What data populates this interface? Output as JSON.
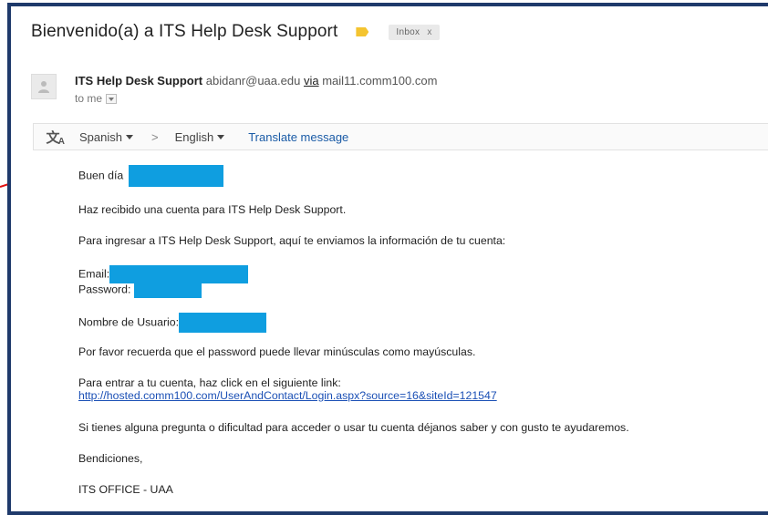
{
  "email": {
    "subject": "Bienvenido(a) a ITS Help Desk Support",
    "folder_chip": "Inbox",
    "folder_chip_close": "x",
    "sender": {
      "name": "ITS Help Desk Support",
      "address": "abidanr@uaa.edu",
      "via_label": "via",
      "via_domain": "mail11.comm100.com"
    },
    "recipient_line": "to me"
  },
  "translate": {
    "source_language": "Spanish",
    "separator": ">",
    "target_language": "English",
    "action_label": "Translate message"
  },
  "message": {
    "greeting": "Buen día",
    "line1": "Haz recibido una cuenta para ITS Help Desk Support.",
    "line2": "Para ingresar a ITS Help Desk Support, aquí te enviamos la información de tu cuenta:",
    "email_label": "Email:",
    "password_label": "Password:",
    "username_label": "Nombre de Usuario:",
    "line3": "Por favor recuerda que el password puede llevar minúsculas como mayúsculas.",
    "line4": "Para entrar a tu cuenta, haz click en el siguiente link:",
    "login_link": "http://hosted.comm100.com/UserAndContact/Login.aspx?source=16&siteId=121547",
    "line5": "Si tienes alguna pregunta o dificultad para acceder o usar tu cuenta déjanos saber y con gusto te ayudaremos.",
    "closing": "Bendiciones,",
    "signature": "ITS OFFICE - UAA"
  },
  "colors": {
    "frame_border": "#1f3a6b",
    "redaction": "#0f9ee0",
    "annotation_arrow": "#e01010",
    "label_tag": "#f4c430",
    "link": "#1a4fb5"
  }
}
